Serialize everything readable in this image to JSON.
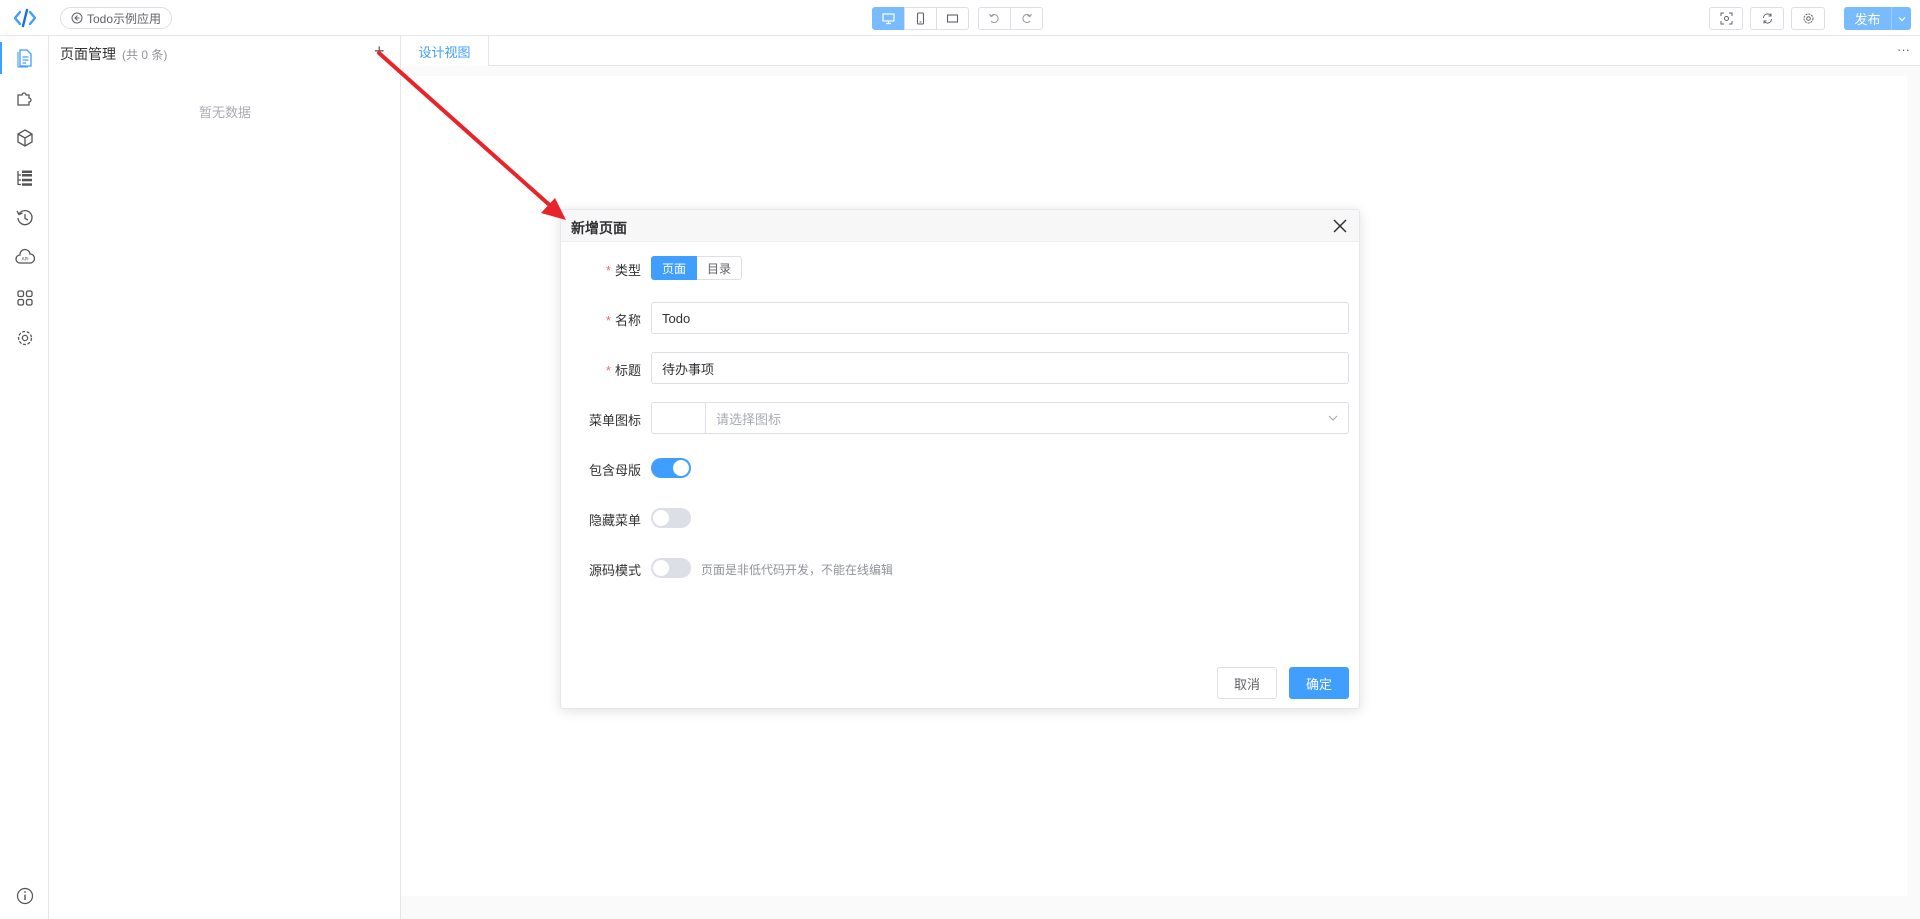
{
  "topbar": {
    "app_name": "Todo示例应用",
    "publish_label": "发布"
  },
  "panel": {
    "title": "页面管理",
    "count": "(共 0 条)",
    "add": "+",
    "empty": "暂无数据"
  },
  "design": {
    "tab_label": "设计视图",
    "more": "···"
  },
  "dialog": {
    "title": "新增页面",
    "type": {
      "label": "类型",
      "options": [
        "页面",
        "目录"
      ],
      "selected": "页面"
    },
    "name": {
      "label": "名称",
      "value": "Todo"
    },
    "title_field": {
      "label": "标题",
      "value": "待办事项"
    },
    "menu_icon": {
      "label": "菜单图标",
      "placeholder": "请选择图标"
    },
    "include_master": {
      "label": "包含母版",
      "on": true
    },
    "hide_menu": {
      "label": "隐藏菜单",
      "on": false
    },
    "source_mode": {
      "label": "源码模式",
      "on": false,
      "hint": "页面是非低代码开发，不能在线编辑"
    },
    "cancel_label": "取消",
    "ok_label": "确定",
    "required_mark": "*"
  },
  "colors": {
    "primary": "#409eff",
    "arrow": "#e8242a"
  }
}
